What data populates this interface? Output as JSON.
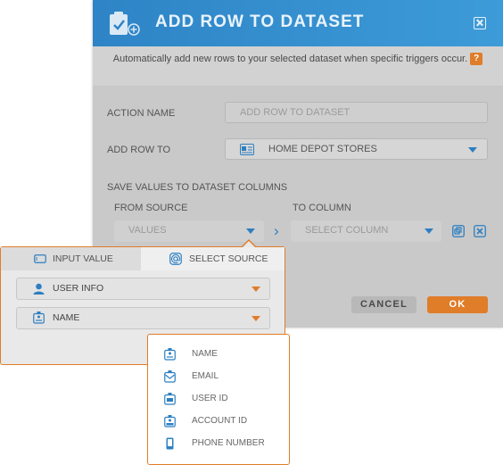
{
  "modal": {
    "title": "ADD ROW TO DATASET",
    "description": "Automatically add new rows to your selected dataset when specific triggers occur.",
    "help_badge": "?",
    "action_name_label": "ACTION NAME",
    "action_name_placeholder": "ADD ROW TO DATASET",
    "add_row_to_label": "ADD ROW TO",
    "add_row_to_value": "HOME DEPOT STORES",
    "save_values_label": "SAVE VALUES TO DATASET COLUMNS",
    "from_source_label": "FROM SOURCE",
    "to_column_label": "TO COLUMN",
    "values_placeholder": "VALUES",
    "select_column_placeholder": "SELECT COLUMN",
    "arrow_glyph": "›",
    "cancel_label": "CANCEL",
    "ok_label": "OK"
  },
  "popover": {
    "tabs": [
      {
        "label": "INPUT VALUE",
        "active": false
      },
      {
        "label": "SELECT SOURCE",
        "active": true
      }
    ],
    "source_select": "USER INFO",
    "field_select": "NAME"
  },
  "dropdown": {
    "items": [
      {
        "label": "NAME",
        "icon": "name-badge-icon"
      },
      {
        "label": "EMAIL",
        "icon": "email-icon"
      },
      {
        "label": "USER ID",
        "icon": "id-card-icon"
      },
      {
        "label": "ACCOUNT ID",
        "icon": "account-id-icon"
      },
      {
        "label": "PHONE NUMBER",
        "icon": "phone-icon"
      }
    ]
  },
  "colors": {
    "header_blue": "#2e84c6",
    "accent_orange": "#e07d29",
    "icon_blue": "#2d7fc1"
  }
}
